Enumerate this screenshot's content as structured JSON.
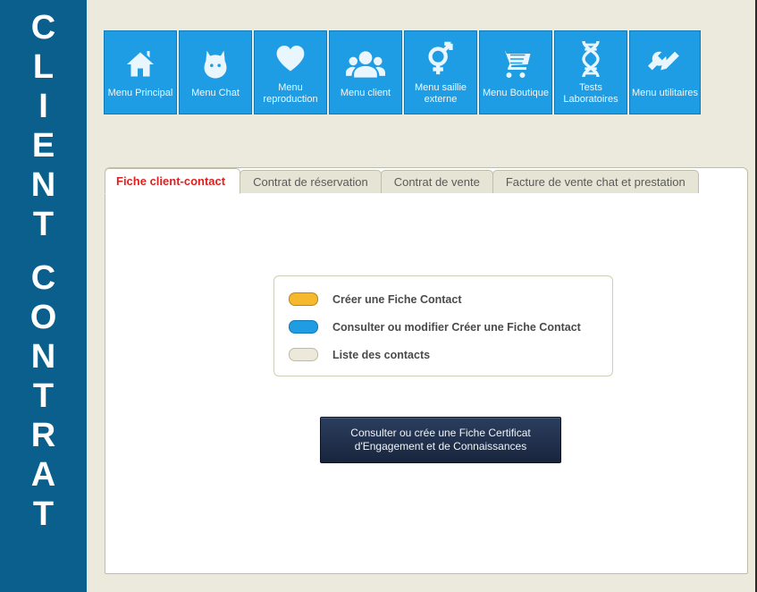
{
  "side_title_top": "CLIENT",
  "side_title_bottom": "CONTRAT",
  "toolbar": [
    {
      "id": "home",
      "label": "Menu Principal"
    },
    {
      "id": "chat",
      "label": "Menu Chat"
    },
    {
      "id": "repro",
      "label": "Menu reproduction"
    },
    {
      "id": "client",
      "label": "Menu client"
    },
    {
      "id": "saillie",
      "label": "Menu saillie externe"
    },
    {
      "id": "shop",
      "label": "Menu Boutique"
    },
    {
      "id": "lab",
      "label": "Tests Laboratoires"
    },
    {
      "id": "util",
      "label": "Menu utilitaires"
    }
  ],
  "tabs": [
    {
      "label": "Fiche client-contact",
      "active": true
    },
    {
      "label": "Contrat de réservation",
      "active": false
    },
    {
      "label": "Contrat de vente",
      "active": false
    },
    {
      "label": "Facture de vente chat et prestation",
      "active": false
    }
  ],
  "options": [
    {
      "color": "orange",
      "label": "Créer une Fiche Contact"
    },
    {
      "color": "blue",
      "label": "Consulter ou modifier Créer une Fiche Contact"
    },
    {
      "color": "grey",
      "label": "Liste des contacts"
    }
  ],
  "certificate_button": "Consulter ou crée une Fiche Certificat d'Engagement et de Connaissances"
}
